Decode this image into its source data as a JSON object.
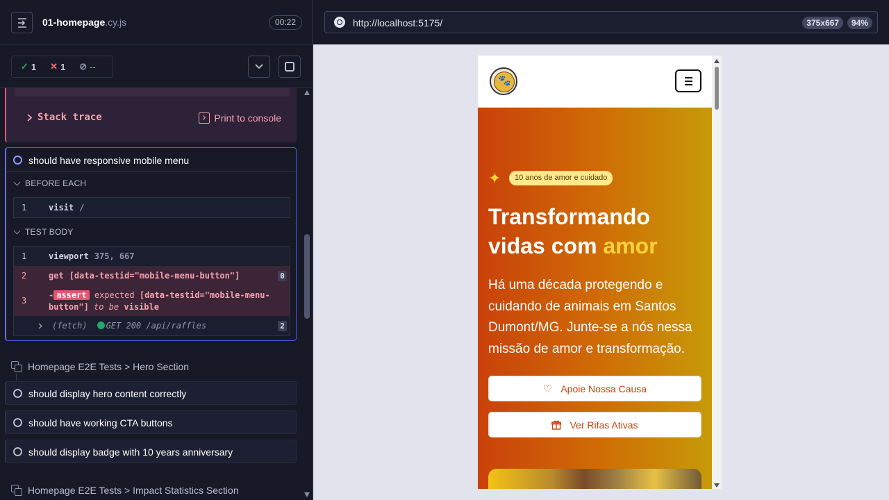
{
  "spec": {
    "name": "01-homepage",
    "ext": ".cy.js",
    "duration": "00:22"
  },
  "stats": {
    "passed": "1",
    "failed": "1",
    "pending": "--"
  },
  "error": {
    "stack_trace_label": "Stack trace",
    "print_label": "Print to console"
  },
  "active_test": {
    "title": "should have responsive mobile menu",
    "before_each_label": "BEFORE EACH",
    "test_body_label": "TEST BODY",
    "before_each": [
      {
        "num": "1",
        "name": "visit",
        "msg": "/"
      }
    ],
    "body": [
      {
        "num": "1",
        "name": "viewport",
        "msg": "375, 667"
      },
      {
        "num": "2",
        "name": "get",
        "msg": "[data-testid=\"mobile-menu-button\"]",
        "count": "0"
      },
      {
        "num": "3",
        "name": "assert",
        "msg_a": "expected",
        "msg_b": "[data-testid=\"mobile-menu-button\"]",
        "msg_c": "to be",
        "msg_d": "visible"
      },
      {
        "name": "(fetch)",
        "msg": "GET 200 /api/raffles",
        "count": "2"
      }
    ]
  },
  "suites": [
    {
      "title": "Homepage E2E Tests > Hero Section",
      "tests": [
        "should display hero content correctly",
        "should have working CTA buttons",
        "should display badge with 10 years anniversary"
      ]
    },
    {
      "title": "Homepage E2E Tests > Impact Statistics Section"
    }
  ],
  "browser": {
    "url": "http://localhost:5175/",
    "viewport": "375x667",
    "zoom": "94%"
  },
  "site": {
    "badge": "10 anos de amor e cuidado",
    "title_a": "Transformando vidas com ",
    "title_hl": "amor",
    "description": "Há uma década protegendo e cuidando de animais em Santos Dumont/MG. Junte-se a nós nessa missão de amor e transformação.",
    "cta_primary": "Apoie Nossa Causa",
    "cta_secondary": "Ver Rifas Ativas"
  },
  "colors": {
    "pass": "#1fa971",
    "fail": "#e45770",
    "active": "#6470f3",
    "hero_start": "#c9410a",
    "hero_end": "#c79a07",
    "highlight": "#ffd23a"
  },
  "icons": [
    "sidebar-toggle-icon",
    "check-icon",
    "x-icon",
    "pending-icon",
    "chevron-down-icon",
    "stop-icon",
    "console-icon",
    "suite-icon",
    "globe-icon",
    "menu-icon",
    "sparkle-icon",
    "heart-icon",
    "gift-icon"
  ]
}
